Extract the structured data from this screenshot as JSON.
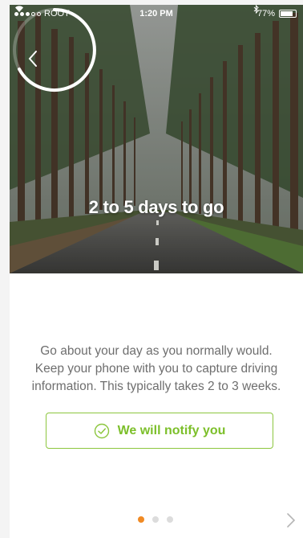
{
  "status_bar": {
    "carrier": "ROOT",
    "time": "1:20 PM",
    "battery": "77%"
  },
  "hero": {
    "progress_label": "2 to 5 days to go"
  },
  "body": {
    "description": "Go about your day as you normally would. Keep your phone with you to capture driving information.  This typically takes 2 to 3 weeks.",
    "notify_button_label": "We will notify you"
  },
  "pager": {
    "page_count": 3,
    "active_index": 0
  },
  "colors": {
    "accent_green": "#8cc63e",
    "active_dot": "#f08a24"
  },
  "icons": {
    "back": "chevron-left-icon",
    "notify": "check-circle-icon",
    "next": "chevron-right-icon"
  }
}
